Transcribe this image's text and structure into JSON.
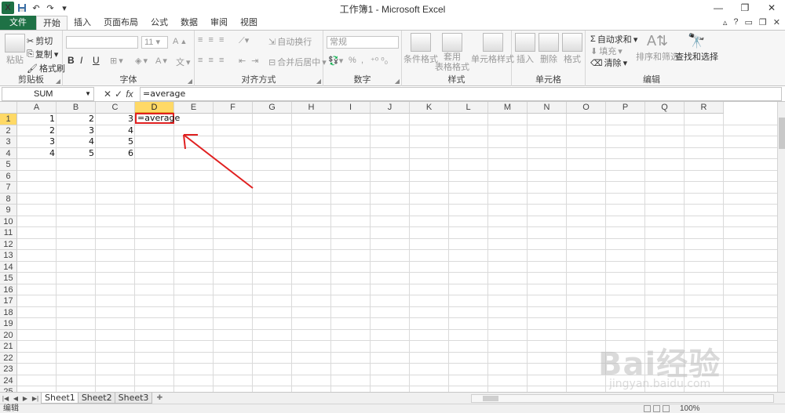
{
  "titlebar": {
    "title": "工作簿1 - Microsoft Excel",
    "logo": "X",
    "qat_icons": [
      "excel-logo-icon",
      "save-icon",
      "undo-icon",
      "redo-icon",
      "customize-icon"
    ],
    "minimize": "—",
    "restore": "❐",
    "close": "✕"
  },
  "tabs": {
    "items": [
      "文件",
      "开始",
      "插入",
      "页面布局",
      "公式",
      "数据",
      "审阅",
      "视图"
    ],
    "active": "开始"
  },
  "ribbon": {
    "clipboard": {
      "label": "剪贴板",
      "paste": "粘贴",
      "cut": "剪切",
      "copy": "复制",
      "format_painter": "格式刷"
    },
    "font": {
      "label": "字体",
      "size": "11",
      "bold": "B",
      "italic": "I",
      "underline": "U",
      "grow": "A",
      "shrink": "A"
    },
    "alignment": {
      "label": "对齐方式",
      "wrap": "自动换行",
      "merge": "合并后居中"
    },
    "number": {
      "label": "数字",
      "format": "常规",
      "percent": "%"
    },
    "styles": {
      "label": "样式",
      "conditional": "条件格式",
      "table_format_1": "套用",
      "table_format_2": "表格格式",
      "cell_styles": "单元格样式"
    },
    "cells": {
      "label": "单元格",
      "insert": "插入",
      "delete": "删除",
      "format": "格式"
    },
    "editing": {
      "label": "编辑",
      "autosum": "自动求和",
      "fill": "填充",
      "clear": "清除",
      "sort_filter": "排序和筛选",
      "find_select": "查找和选择"
    }
  },
  "formula_bar": {
    "name_box": "SUM",
    "cancel": "✕",
    "enter": "✓",
    "fx": "fx",
    "content": "=average"
  },
  "grid": {
    "columns": [
      "A",
      "B",
      "C",
      "D",
      "E",
      "F",
      "G",
      "H",
      "I",
      "J",
      "K",
      "L",
      "M",
      "N",
      "O",
      "P",
      "Q",
      "R"
    ],
    "active_column": "D",
    "rows": [
      "1",
      "2",
      "3",
      "4",
      "5",
      "6",
      "7",
      "8",
      "9",
      "10",
      "11",
      "12",
      "13",
      "14",
      "15",
      "16",
      "17",
      "18",
      "19",
      "20",
      "21",
      "22",
      "23",
      "24",
      "25"
    ],
    "active_row": "1",
    "cells": [
      [
        "1",
        "2",
        "3"
      ],
      [
        "2",
        "3",
        "4"
      ],
      [
        "3",
        "4",
        "5"
      ],
      [
        "4",
        "5",
        "6"
      ]
    ],
    "active_cell_text": "=average"
  },
  "sheets": [
    "Sheet1",
    "Sheet2",
    "Sheet3"
  ],
  "active_sheet": "Sheet1",
  "status": {
    "mode": "编辑",
    "zoom": "100%"
  },
  "watermark": {
    "main": "Bai经验",
    "sub": "jingyan.baidu.com"
  },
  "colors": {
    "excel_green": "#1e7145",
    "highlight": "#ffd966",
    "annotation_red": "#e02020"
  }
}
